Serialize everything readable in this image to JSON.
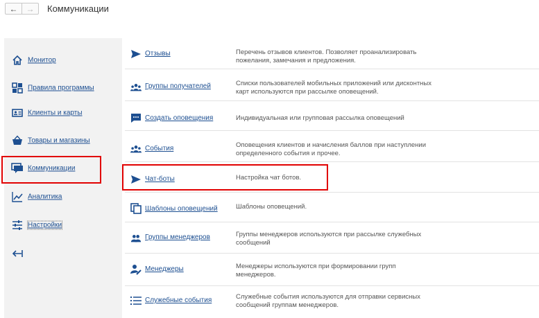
{
  "header": {
    "back_icon": "arrow-left-icon",
    "forward_icon": "arrow-right-icon",
    "title": "Коммуникации"
  },
  "sidebar": {
    "items": [
      {
        "label": "Монитор",
        "icon": "home-icon"
      },
      {
        "label": "Правила программы",
        "icon": "grid-icon"
      },
      {
        "label": "Клиенты и карты",
        "icon": "id-card-icon"
      },
      {
        "label": "Товары и магазины",
        "icon": "basket-icon"
      },
      {
        "label": "Коммуникации",
        "icon": "chat-icon",
        "active": true
      },
      {
        "label": "Аналитика",
        "icon": "chart-icon"
      },
      {
        "label": "Настройки",
        "icon": "sliders-icon"
      }
    ],
    "collapse_icon": "collapse-left-icon"
  },
  "rows": [
    {
      "link": "Отзывы",
      "icon": "send-icon",
      "desc": "Перечень отзывов клиентов. Позволяет проанализировать пожелания, замечания и предложения."
    },
    {
      "link": "Группы получателей",
      "icon": "users-icon",
      "desc": "Списки пользователей мобильных приложений или дисконтных карт используются при рассылке оповещений."
    },
    {
      "link": "Создать оповещения",
      "icon": "message-icon",
      "desc": "Индивидуальная или групповая рассылка оповещений"
    },
    {
      "link": "События",
      "icon": "users-icon",
      "desc": "Оповещения клиентов и начисления баллов при наступлении определенного события и прочее."
    },
    {
      "link": "Чат-боты",
      "icon": "send-icon",
      "desc": "Настройка чат ботов."
    },
    {
      "link": "Шаблоны оповещений",
      "icon": "copy-icon",
      "desc": "Шаблоны оповещений."
    },
    {
      "link": "Группы менеджеров",
      "icon": "users-icon",
      "desc": "Группы менеджеров используются при рассылке служебных сообщений"
    },
    {
      "link": "Менеджеры",
      "icon": "user-edit-icon",
      "desc": "Менеджеры используются при формировании групп менеджеров."
    },
    {
      "link": "Служебные события",
      "icon": "list-icon",
      "desc": "Служебные события используются для отправки сервисных сообщений группам менеджеров."
    }
  ],
  "colors": {
    "link": "#1d4f91",
    "icon": "#1d4f91",
    "highlight": "#e10000",
    "sidebar_bg": "#f2f2f2"
  }
}
